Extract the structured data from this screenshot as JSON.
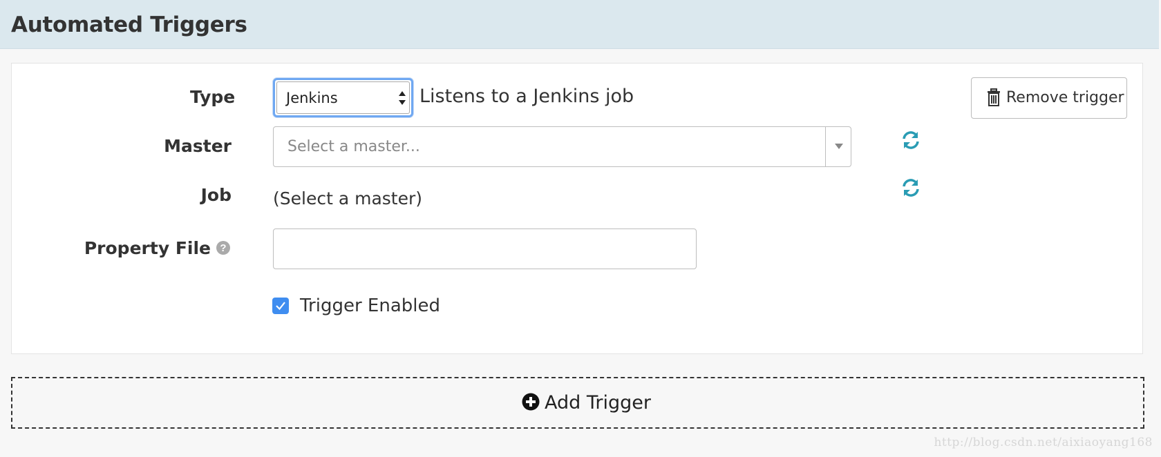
{
  "header": {
    "title": "Automated Triggers"
  },
  "trigger": {
    "type_label": "Type",
    "type_value": "Jenkins",
    "type_description": "Listens to a Jenkins job",
    "remove_label": "Remove trigger",
    "master_label": "Master",
    "master_placeholder": "Select a master...",
    "job_label": "Job",
    "job_value": "(Select a master)",
    "property_file_label": "Property File",
    "property_file_value": "",
    "enabled_label": "Trigger Enabled",
    "enabled": true
  },
  "add_trigger_label": "Add Trigger",
  "watermark": "http://blog.csdn.net/aixiaoyang168",
  "colors": {
    "header_bg": "#dbe8ee",
    "accent_blue": "#3f8df0",
    "refresh_teal": "#2a9cb4",
    "focus_ring": "#6fa8f2"
  },
  "icons": [
    "trash-icon",
    "refresh-icon",
    "help-icon",
    "checkmark-icon",
    "plus-circle-icon",
    "updown-arrows-icon",
    "caret-down-icon"
  ]
}
